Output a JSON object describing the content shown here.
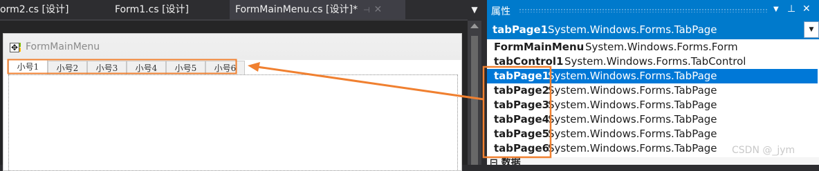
{
  "doc_tabs": [
    {
      "label": "orm2.cs [设计]",
      "active": false
    },
    {
      "label": "Form1.cs [设计]",
      "active": false
    },
    {
      "label": "FormMainMenu.cs [设计]*",
      "active": true
    }
  ],
  "designer": {
    "form_title": "FormMainMenu",
    "tabs": [
      "小号1",
      "小号2",
      "小号3",
      "小号4",
      "小号5",
      "小号6"
    ]
  },
  "properties": {
    "title": "属性",
    "selected": {
      "name": "tabPage1",
      "type": "System.Windows.Forms.TabPage"
    },
    "items": [
      {
        "name": "FormMainMenu",
        "type": "System.Windows.Forms.Form"
      },
      {
        "name": "tabControl1",
        "type": "System.Windows.Forms.TabControl"
      },
      {
        "name": "tabPage1",
        "type": "System.Windows.Forms.TabPage"
      },
      {
        "name": "tabPage2",
        "type": "System.Windows.Forms.TabPage"
      },
      {
        "name": "tabPage3",
        "type": "System.Windows.Forms.TabPage"
      },
      {
        "name": "tabPage4",
        "type": "System.Windows.Forms.TabPage"
      },
      {
        "name": "tabPage5",
        "type": "System.Windows.Forms.TabPage"
      },
      {
        "name": "tabPage6",
        "type": "System.Windows.Forms.TabPage"
      }
    ],
    "section_label": "数据"
  },
  "watermark": "CSDN @_jym",
  "colors": {
    "accent": "#007acc",
    "selection": "#0078d7",
    "annotation": "#f08030",
    "ide_background": "#2d2d30"
  }
}
